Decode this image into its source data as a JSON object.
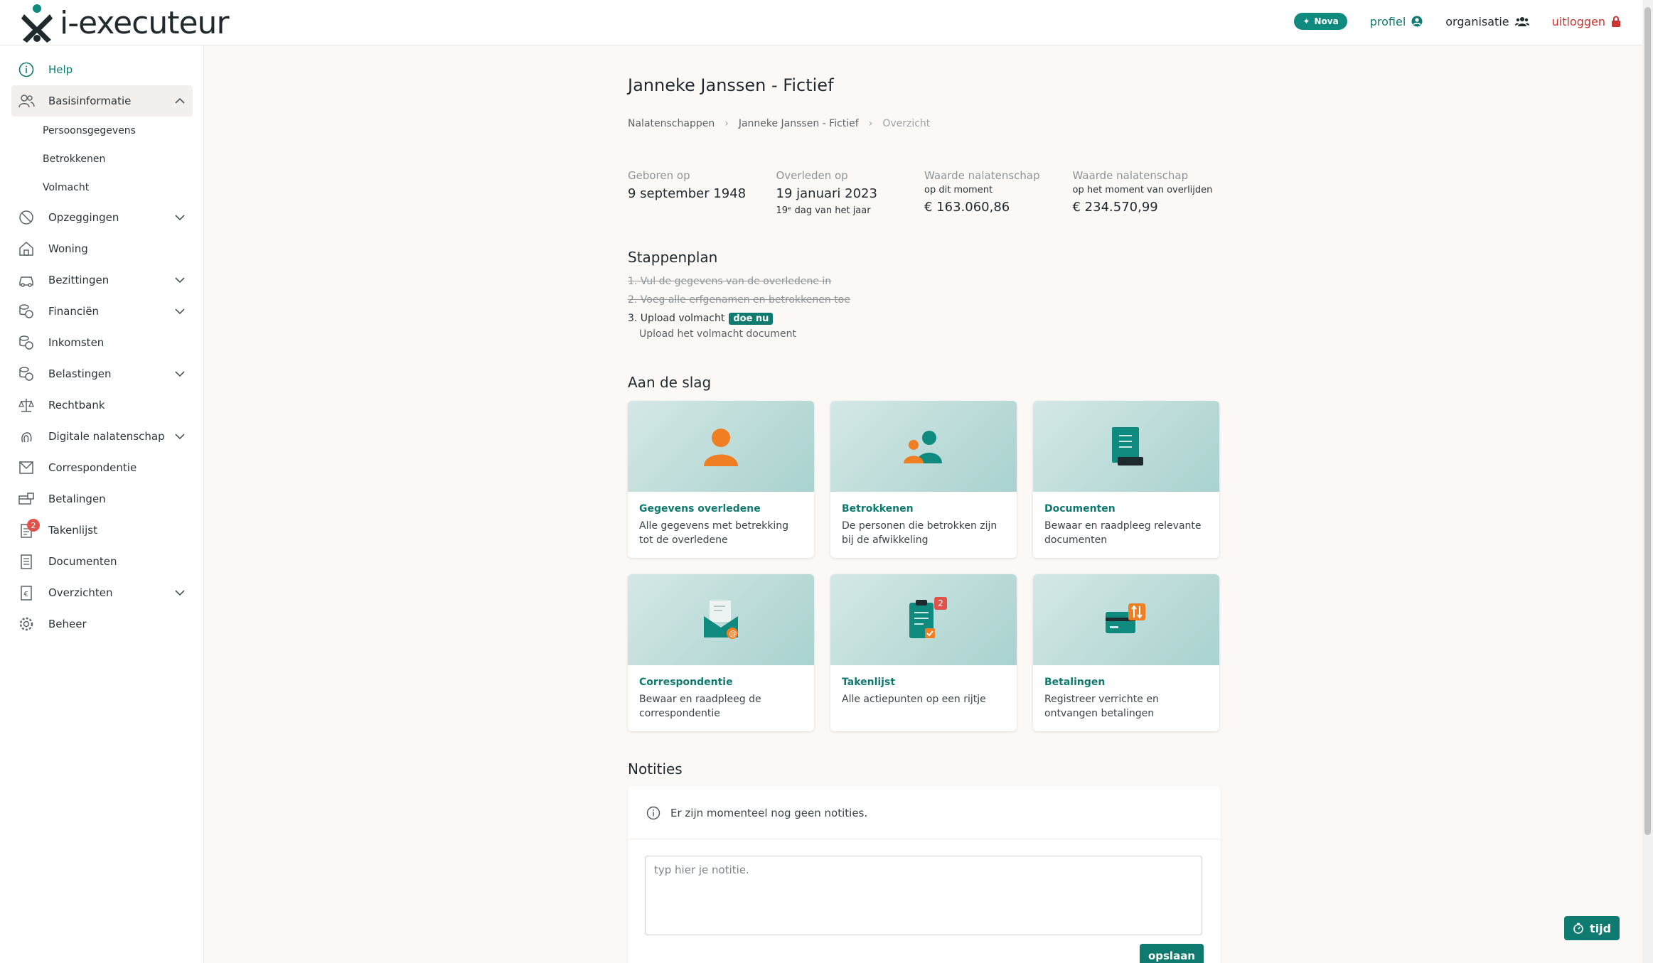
{
  "brand": {
    "name": "i-executeur",
    "accent": "#0f7a70"
  },
  "topnav": {
    "nova": "Nova",
    "profiel": "profiel",
    "organisatie": "organisatie",
    "uitloggen": "uitloggen"
  },
  "sidebar": {
    "help": "Help",
    "basisinformatie": "Basisinformatie",
    "sub": [
      "Persoonsgegevens",
      "Betrokkenen",
      "Volmacht"
    ],
    "items": [
      {
        "label": "Opzeggingen"
      },
      {
        "label": "Woning"
      },
      {
        "label": "Bezittingen"
      },
      {
        "label": "Financiën"
      },
      {
        "label": "Inkomsten"
      },
      {
        "label": "Belastingen"
      },
      {
        "label": "Rechtbank"
      },
      {
        "label": "Digitale nalatenschap"
      },
      {
        "label": "Correspondentie"
      },
      {
        "label": "Betalingen"
      },
      {
        "label": "Takenlijst",
        "badge": "2"
      },
      {
        "label": "Documenten"
      },
      {
        "label": "Overzichten"
      },
      {
        "label": "Beheer"
      }
    ]
  },
  "page": {
    "title": "Janneke Janssen - Fictief",
    "breadcrumb": [
      "Nalatenschappen",
      "Janneke Janssen - Fictief",
      "Overzicht"
    ]
  },
  "stats": {
    "born_label": "Geboren op",
    "born_value": "9 september 1948",
    "died_label": "Overleden op",
    "died_value": "19 januari 2023",
    "died_note": "19ᵉ dag van het jaar",
    "estate_now_label": "Waarde nalatenschap",
    "estate_now_sub": "op dit moment",
    "estate_now_value": "€ 163.060,86",
    "estate_death_label": "Waarde nalatenschap",
    "estate_death_sub": "op het moment van overlijden",
    "estate_death_value": "€ 234.570,99"
  },
  "stappenplan": {
    "title": "Stappenplan",
    "steps": [
      "1. Vul de gegevens van de overledene in",
      "2. Voeg alle erfgenamen en betrokkenen toe",
      "3. Upload volmacht"
    ],
    "doe_nu": "doe nu",
    "step3_sub": "Upload het volmacht document"
  },
  "aan_de_slag": {
    "title": "Aan de slag",
    "cards": [
      {
        "title": "Gegevens overledene",
        "desc": "Alle gegevens met betrekking tot de overledene"
      },
      {
        "title": "Betrokkenen",
        "desc": "De personen die betrokken zijn bij de afwikkeling"
      },
      {
        "title": "Documenten",
        "desc": "Bewaar en raadpleeg relevante documenten"
      },
      {
        "title": "Correspondentie",
        "desc": "Bewaar en raadpleeg de correspondentie"
      },
      {
        "title": "Takenlijst",
        "desc": "Alle actiepunten op een rijtje",
        "badge": "2"
      },
      {
        "title": "Betalingen",
        "desc": "Registreer verrichte en ontvangen betalingen"
      }
    ]
  },
  "notities": {
    "title": "Notities",
    "empty": "Er zijn momenteel nog geen notities.",
    "placeholder": "typ hier je notitie.",
    "save": "opslaan"
  },
  "tijd": "tijd"
}
